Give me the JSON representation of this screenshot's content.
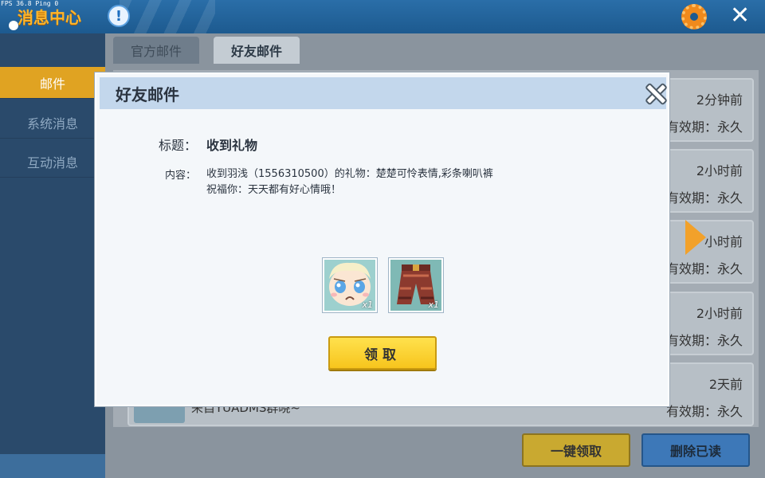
{
  "debug": {
    "fps_text": "FPS 36.8  Ping 0"
  },
  "header": {
    "title": "消息中心",
    "info_glyph": "!",
    "close_glyph": "✕"
  },
  "sidebar": {
    "items": [
      {
        "label": "邮件",
        "active": true
      },
      {
        "label": "系统消息",
        "active": false
      },
      {
        "label": "互动消息",
        "active": false
      }
    ]
  },
  "tabs": [
    {
      "label": "官方邮件",
      "active": false
    },
    {
      "label": "好友邮件",
      "active": true
    }
  ],
  "mail_list": {
    "rows": [
      {
        "time": "2分钟前",
        "expiry": "有效期：永久"
      },
      {
        "time": "2小时前",
        "expiry": "有效期：永久"
      },
      {
        "time": "小时前",
        "expiry": "有效期：永久"
      },
      {
        "time": "2小时前",
        "expiry": "有效期：永久"
      },
      {
        "time": "2天前",
        "expiry": "有效期：永久",
        "from": "来自YUADMS群晓~"
      }
    ]
  },
  "footer_buttons": {
    "claim_all": "一键领取",
    "delete_read": "删除已读"
  },
  "modal": {
    "title": "好友邮件",
    "subject_label": "标题：",
    "subject_value": "收到礼物",
    "content_label": "内容：",
    "content_lines": [
      "收到羽浅（1556310500）的礼物：楚楚可怜表情,彩条喇叭裤",
      "祝福你：天天都有好心情哦！"
    ],
    "rewards": [
      {
        "name": "楚楚可怜表情",
        "qty": "x1",
        "icon": "sad-face-icon"
      },
      {
        "name": "彩条喇叭裤",
        "qty": "x1",
        "icon": "pants-icon"
      }
    ],
    "claim_label": "领取"
  },
  "colors": {
    "accent": "#f7c51d",
    "header_blue": "#1d5a8f",
    "modal_header": "#c3d7ec"
  }
}
